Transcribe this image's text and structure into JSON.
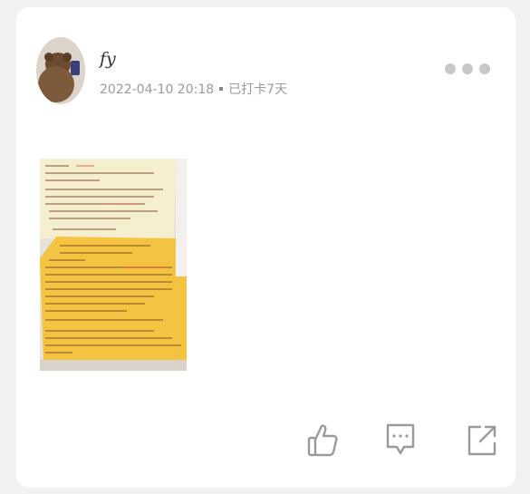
{
  "post": {
    "username": "fy",
    "timestamp": "2022-04-10 20:18",
    "checkin": "已打卡7天"
  },
  "icons": {
    "more": "more-dots-icon",
    "like": "thumbs-up-icon",
    "comment": "comment-bubble-icon",
    "share": "share-icon"
  },
  "colors": {
    "icon": "#9a9a9a",
    "meta": "#9a9a9a",
    "paper": "#f5c342"
  }
}
